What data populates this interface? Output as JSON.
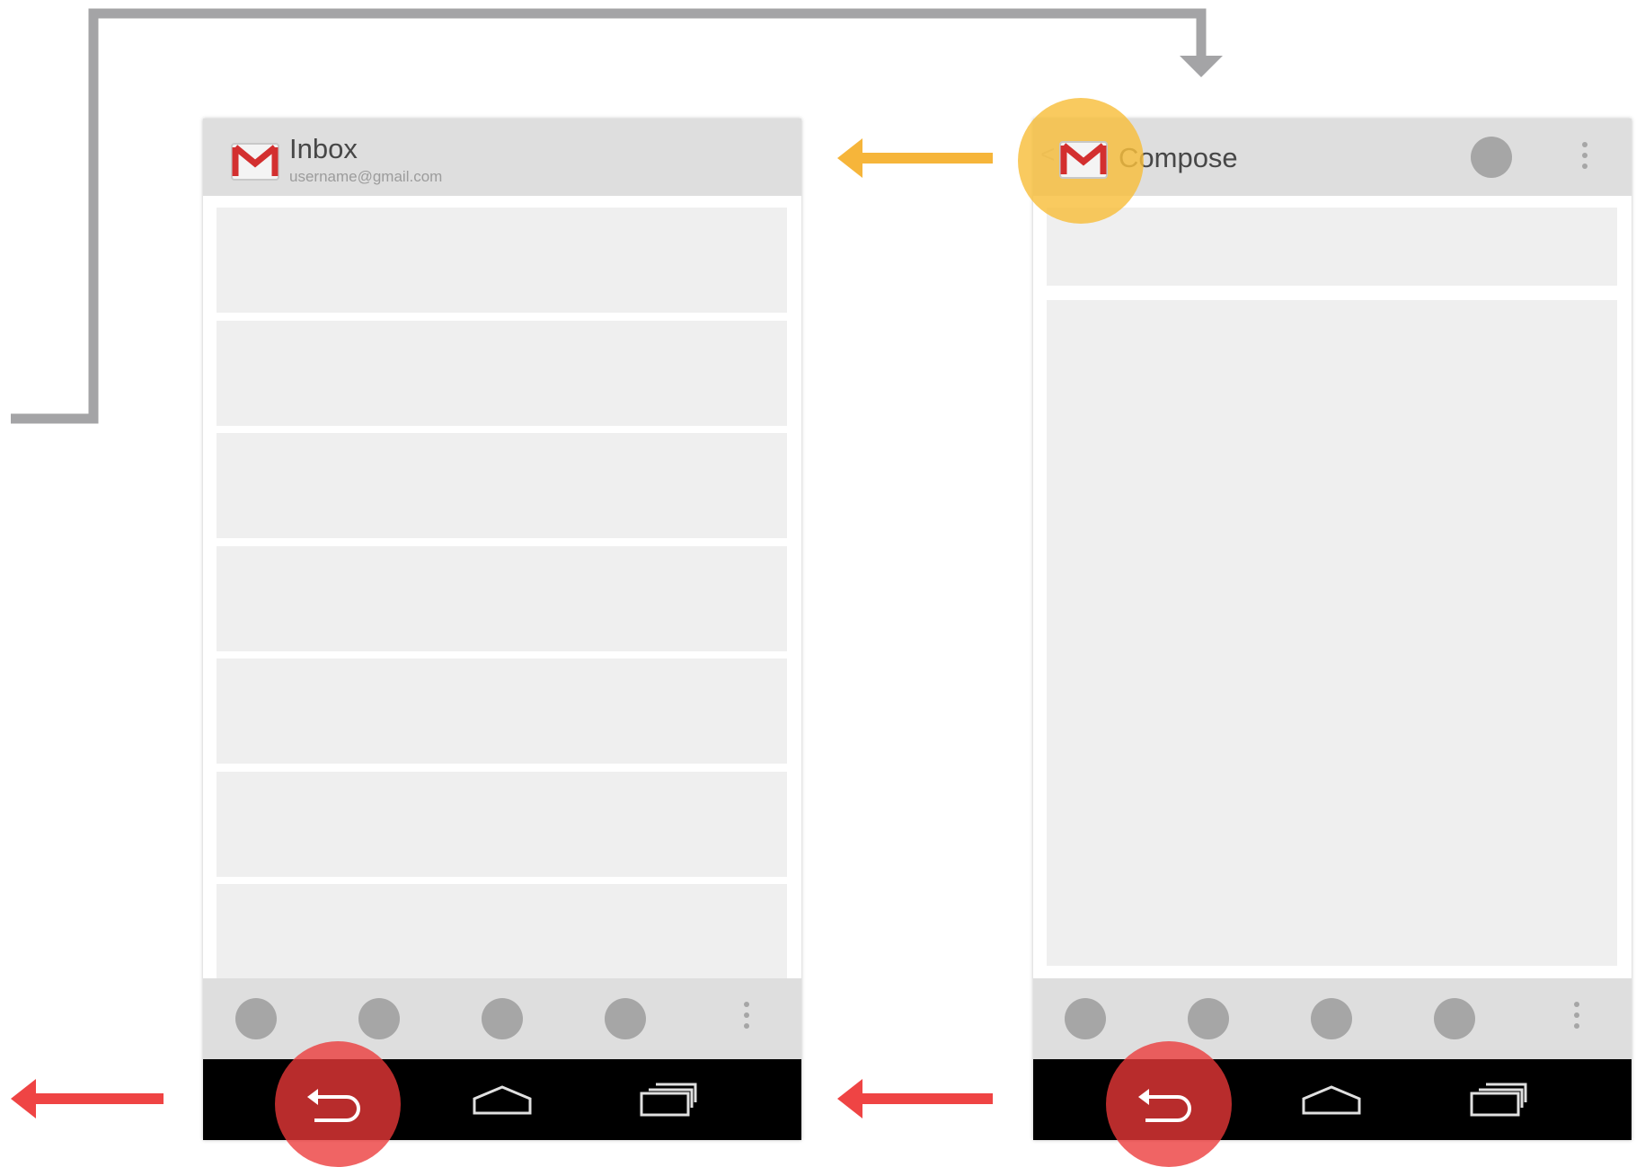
{
  "colors": {
    "connector": "#a4a4a6",
    "up_arrow": "#f6b53a",
    "back_arrow": "#ef4444",
    "up_highlight": "#f8be3c",
    "back_highlight": "#ec3838"
  },
  "inbox_screen": {
    "title": "Inbox",
    "subtitle": "username@gmail.com",
    "app_icon": "gmail-icon",
    "list_rows": 7,
    "bottom_actions": [
      "action-icon",
      "action-icon",
      "action-icon",
      "action-icon",
      "overflow-menu-icon"
    ],
    "nav_buttons": [
      "back-icon",
      "home-icon",
      "recent-apps-icon"
    ]
  },
  "compose_screen": {
    "title": "Compose",
    "up_caret": "<",
    "app_icon": "gmail-icon",
    "top_actions": [
      "action-icon",
      "overflow-menu-icon"
    ],
    "bottom_actions": [
      "action-icon",
      "action-icon",
      "action-icon",
      "action-icon",
      "overflow-menu-icon"
    ],
    "nav_buttons": [
      "back-icon",
      "home-icon",
      "recent-apps-icon"
    ]
  }
}
